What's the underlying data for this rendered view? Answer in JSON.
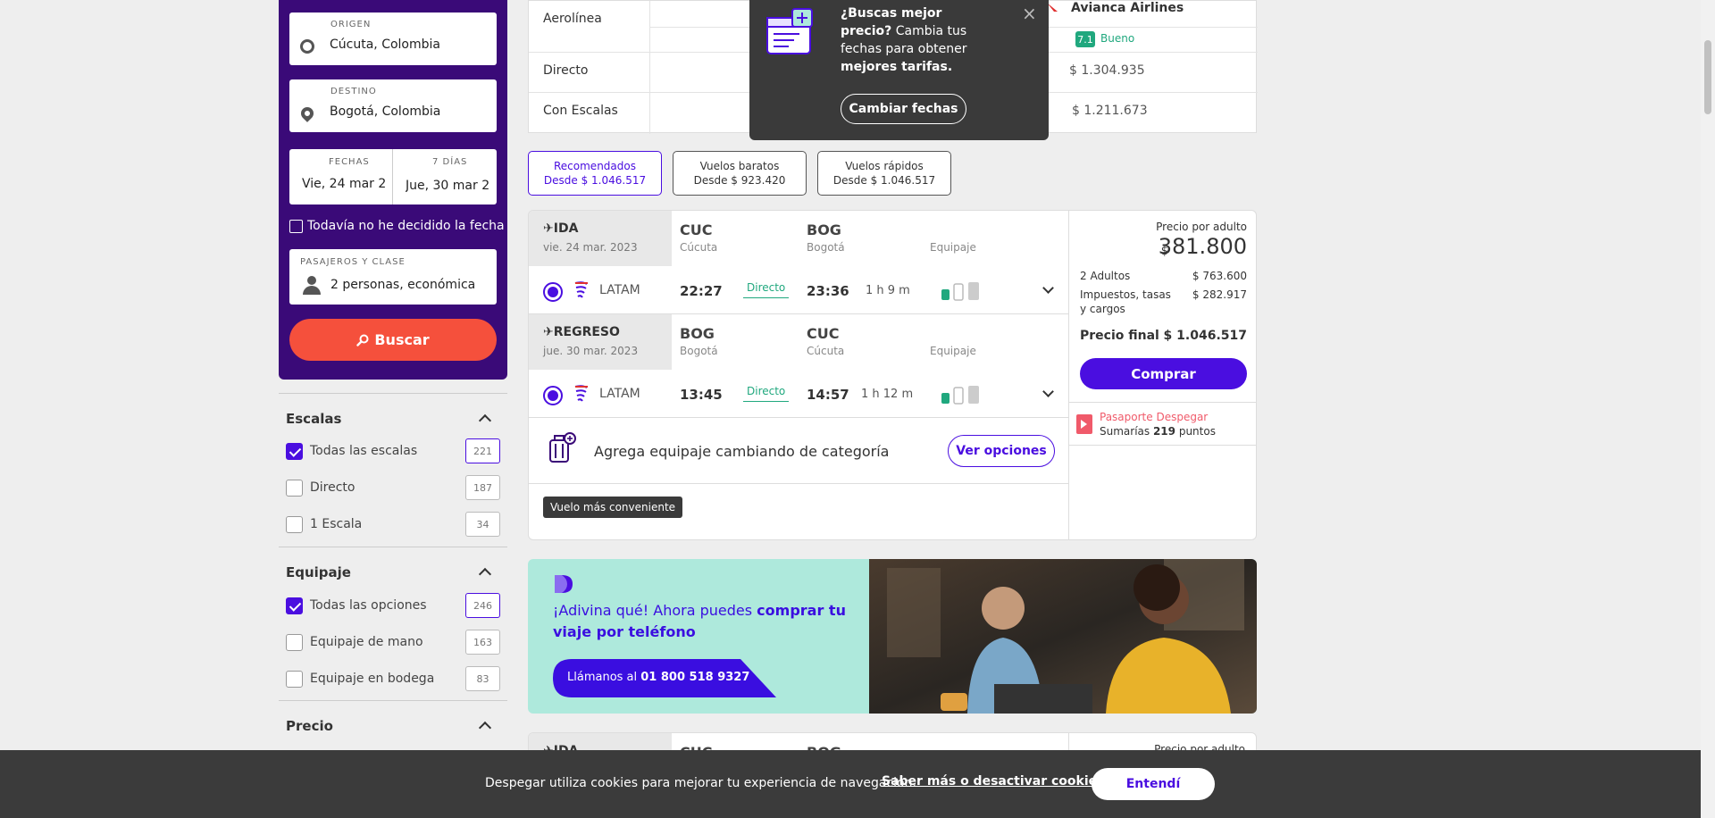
{
  "search": {
    "origin_label": "ORIGEN",
    "origin_value": "Cúcuta, Colombia",
    "destination_label": "DESTINO",
    "destination_value": "Bogotá, Colombia",
    "dates_label": "FECHAS",
    "days_label": "7 DÍAS",
    "depart_value": "Vie, 24 mar 2",
    "return_value": "Jue, 30 mar 2",
    "undecided_label": "Todavía no he decidido la fecha",
    "passengers_label": "PASAJEROS Y CLASE",
    "passengers_value": "2 personas, económica",
    "search_button": "Buscar"
  },
  "filters": {
    "stops": {
      "title": "Escalas",
      "options": [
        {
          "label": "Todas las escalas",
          "count": "221",
          "checked": true
        },
        {
          "label": "Directo",
          "count": "187",
          "checked": false
        },
        {
          "label": "1 Escala",
          "count": "34",
          "checked": false
        }
      ]
    },
    "luggage": {
      "title": "Equipaje",
      "options": [
        {
          "label": "Todas las opciones",
          "count": "246",
          "checked": true
        },
        {
          "label": "Equipaje de mano",
          "count": "163",
          "checked": false
        },
        {
          "label": "Equipaje en bodega",
          "count": "83",
          "checked": false
        }
      ]
    },
    "price": {
      "title": "Precio"
    }
  },
  "comparison": {
    "rows": [
      "Aerolínea",
      "Directo",
      "Con Escalas"
    ],
    "airline": "Avianca Airlines",
    "rating_score": "7.1",
    "rating_text": "Bueno",
    "direct_price": "$ 1.304.935",
    "stops_price": "$ 1.211.673"
  },
  "tooltip": {
    "line1": "¿Buscas mejor",
    "line2_bold": "precio?",
    "line2_rest": " Cambia tus",
    "line3": "fechas para obtener",
    "line4": "mejores tarifas.",
    "button": "Cambiar fechas",
    "close": "×"
  },
  "sort_tabs": [
    {
      "title": "Recomendados",
      "subtitle": "Desde $ 1.046.517",
      "active": true
    },
    {
      "title": "Vuelos baratos",
      "subtitle": "Desde $ 923.420",
      "active": false
    },
    {
      "title": "Vuelos rápidos",
      "subtitle": "Desde $ 1.046.517",
      "active": false
    }
  ],
  "result": {
    "outbound": {
      "title": "IDA",
      "date": "vie. 24 mar. 2023",
      "from_code": "CUC",
      "from_city": "Cúcuta",
      "to_code": "BOG",
      "to_city": "Bogotá",
      "luggage_label": "Equipaje",
      "airline": "LATAM",
      "depart": "22:27",
      "stops": "Directo",
      "arrive": "23:36",
      "duration": "1 h 9 m"
    },
    "return": {
      "title": "REGRESO",
      "date": "jue. 30 mar. 2023",
      "from_code": "BOG",
      "from_city": "Bogotá",
      "to_code": "CUC",
      "to_city": "Cúcuta",
      "luggage_label": "Equipaje",
      "airline": "LATAM",
      "depart": "13:45",
      "stops": "Directo",
      "arrive": "14:57",
      "duration": "1 h 12 m"
    },
    "luggage_upsell": "Agrega equipaje cambiando de categoría",
    "options_button": "Ver opciones",
    "badge": "Vuelo más conveniente",
    "price": {
      "per_adult_label": "Precio por adulto",
      "currency": "$",
      "per_adult": "381.800",
      "adults_label": "2 Adultos",
      "adults_value": "$ 763.600",
      "taxes_label_1": "Impuestos, tasas",
      "taxes_label_2": "y cargos",
      "taxes_value": "$ 282.917",
      "final_label": "Precio final",
      "final_value": "$ 1.046.517",
      "buy_button": "Comprar"
    },
    "passport": {
      "title": "Pasaporte Despegar",
      "sub_prefix": "Sumarías ",
      "points": "219",
      "sub_suffix": " puntos"
    }
  },
  "banner": {
    "text_prefix": "¡Adivina qué! Ahora puedes ",
    "text_bold": "comprar tu viaje por teléfono",
    "call_prefix": "Llámanos al ",
    "phone": "01 800 518 9327"
  },
  "next_card": {
    "title": "IDA",
    "from_code": "CUC",
    "to_code": "BOG",
    "per_adult_label": "Precio por adulto"
  },
  "cookie": {
    "text": "Despegar utiliza cookies para mejorar tu experiencia de navegación.",
    "link": "Saber más o desactivar cookies.",
    "button": "Entendí"
  },
  "colors": {
    "brand_purple": "#4a0ee0",
    "panel_purple": "#3a0a78",
    "search_red": "#f5503c",
    "success_green": "#20a87e",
    "banner_mint": "#aee9dc"
  }
}
